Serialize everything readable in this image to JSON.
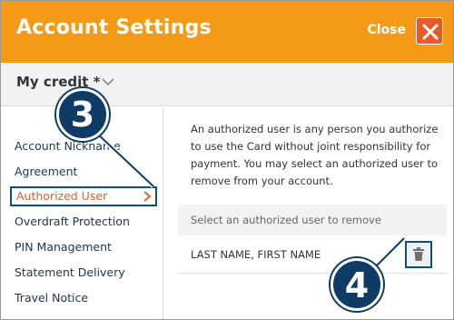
{
  "header": {
    "title": "Account Settings",
    "close_label": "Close",
    "background_color": "#f59a16",
    "close_button_color": "#ea5a28"
  },
  "account_selector": {
    "value": "My credit *",
    "icon": "chevron-down-icon"
  },
  "sidebar": {
    "items": [
      {
        "label": "Account Nickname",
        "active": false
      },
      {
        "label": "Agreement",
        "active": false
      },
      {
        "label": "Authorized User",
        "active": true
      },
      {
        "label": "Overdraft Protection",
        "active": false
      },
      {
        "label": "PIN Management",
        "active": false
      },
      {
        "label": "Statement Delivery",
        "active": false
      },
      {
        "label": "Travel Notice",
        "active": false
      }
    ],
    "active_color": "#e85b23",
    "highlight_color": "#0f4d86"
  },
  "content": {
    "description": "An authorized user is any person you authorize to use the Card without joint responsibility for payment. You may select an authorized user to remove from your account.",
    "list_header": "Select an authorized user to remove",
    "users": [
      {
        "name": "LAST NAME, FIRST NAME",
        "action_icon": "trash-icon"
      }
    ]
  },
  "callouts": [
    {
      "label": "3"
    },
    {
      "label": "4"
    }
  ]
}
